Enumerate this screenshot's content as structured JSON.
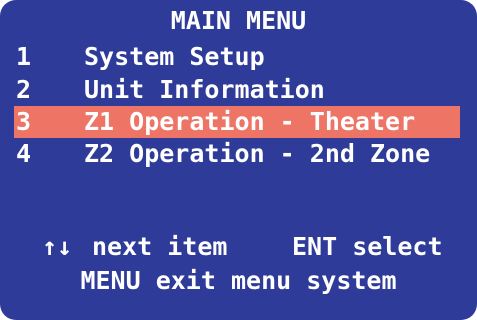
{
  "menu": {
    "title": "MAIN MENU",
    "items": [
      {
        "number": "1",
        "label": "System Setup",
        "selected": false
      },
      {
        "number": "2",
        "label": "Unit Information",
        "selected": false
      },
      {
        "number": "3",
        "label": "Z1 Operation - Theater",
        "selected": true
      },
      {
        "number": "4",
        "label": "Z2 Operation - 2nd Zone",
        "selected": false
      }
    ]
  },
  "hints": {
    "arrows_glyph": "↑↓",
    "next_label": "next item",
    "ent_label": "ENT select",
    "exit_label": "MENU exit menu system"
  },
  "colors": {
    "background": "#2e3b98",
    "highlight": "#ee7466",
    "text": "#ffffff"
  }
}
